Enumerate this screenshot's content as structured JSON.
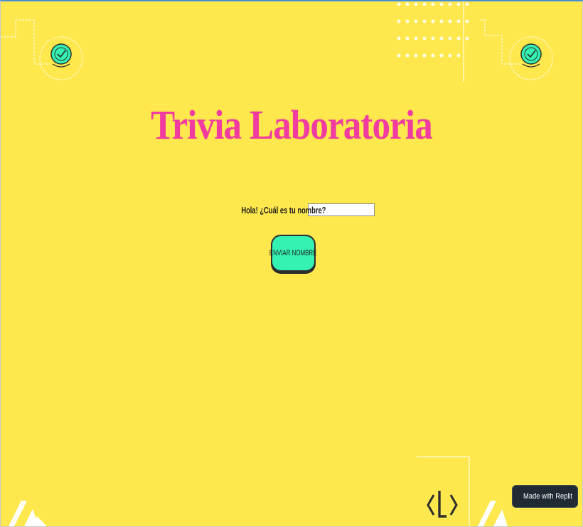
{
  "title": "Trivia Laboratoria",
  "form": {
    "label": "Hola! ¿Cuál es tu nombre?",
    "input_value": "",
    "input_placeholder": "",
    "submit_label": "ENVIAR NOMBRE"
  },
  "badge": {
    "label": "Made with Replit",
    "icon": "replit-icon"
  },
  "icons": [
    "badge-check-icon",
    "laboratoria-logo-icon"
  ],
  "colors": {
    "background": "#fee84d",
    "title": "#f03ba0",
    "button": "#34f2b2",
    "badge_background": "#1f2a33"
  }
}
